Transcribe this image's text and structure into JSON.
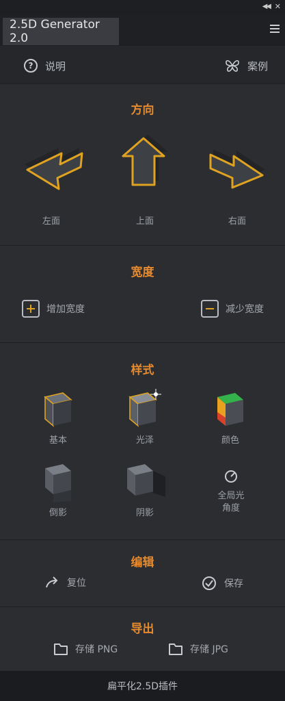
{
  "window": {
    "title": "2.5D Generator 2.0",
    "collapse_icon": "collapse-icon",
    "close_icon": "close-icon",
    "menu_icon": "panel-menu-icon"
  },
  "nav": {
    "help_label": "说明",
    "examples_label": "案例"
  },
  "sections": {
    "direction": {
      "title": "方向",
      "left": "左面",
      "up": "上面",
      "right": "右面"
    },
    "width": {
      "title": "宽度",
      "increase": "增加宽度",
      "decrease": "减少宽度"
    },
    "style": {
      "title": "样式",
      "basic": "基本",
      "gloss": "光泽",
      "color": "颜色",
      "reflection": "倒影",
      "shadow": "阴影",
      "global_light_1": "全局光",
      "global_light_2": "角度"
    },
    "edit": {
      "title": "编辑",
      "reset": "复位",
      "save": "保存"
    },
    "export": {
      "title": "导出",
      "png": "存储 PNG",
      "jpg": "存储 JPG"
    }
  },
  "footer": {
    "text": "扁平化2.5D插件"
  },
  "colors": {
    "accent": "#e58a2f",
    "panel": "#2b2d31",
    "arrow_fill": "#3d4045",
    "arrow_outline": "#e0a321"
  }
}
